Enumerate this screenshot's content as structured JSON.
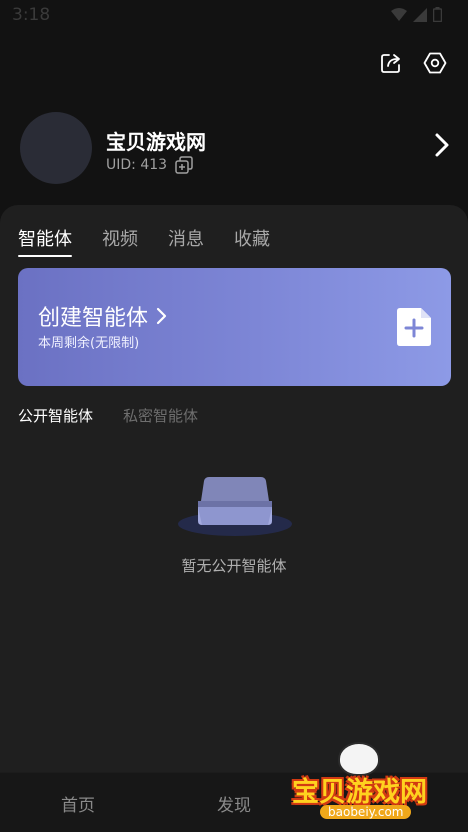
{
  "status_bar": {
    "time": "3:18"
  },
  "top_actions": {
    "share_icon": "share-icon",
    "settings_icon": "settings-icon"
  },
  "profile": {
    "name": "宝贝游戏网",
    "uid": "UID: 413"
  },
  "tabs": [
    {
      "label": "智能体",
      "active": true
    },
    {
      "label": "视频",
      "active": false
    },
    {
      "label": "消息",
      "active": false
    },
    {
      "label": "收藏",
      "active": false
    }
  ],
  "create_card": {
    "title": "创建智能体",
    "subtitle": "本周剩余(无限制)"
  },
  "subtabs": [
    {
      "label": "公开智能体",
      "active": true
    },
    {
      "label": "私密智能体",
      "active": false
    }
  ],
  "empty_state": {
    "message": "暂无公开智能体"
  },
  "bottom_nav": {
    "home": "首页",
    "discover": "发现"
  },
  "watermark": {
    "name": "宝贝游戏网",
    "url": "baobeiy.com"
  },
  "colors": {
    "background": "#121212",
    "panel": "#1f1f1f",
    "card_start": "#6b71c3",
    "card_end": "#8d9ae6"
  }
}
